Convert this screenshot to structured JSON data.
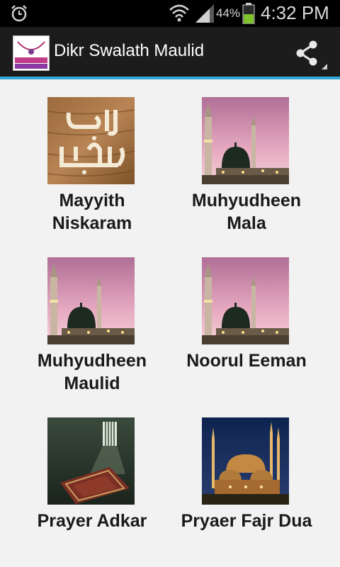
{
  "status_bar": {
    "battery_percent": "44%",
    "time": "4:32 PM",
    "icons": [
      "alarm-icon",
      "wifi-icon",
      "signal-icon",
      "battery-icon"
    ]
  },
  "action_bar": {
    "title": "Dikr Swalath Maulid",
    "logo_text": "adkar-aurad swalath-maulid",
    "share_icon": "share-icon"
  },
  "colors": {
    "accent": "#2fa7d8",
    "action_bar_bg": "#1c1c1c",
    "page_bg": "#f2f2f2",
    "battery": "#7ec22b"
  },
  "items": [
    {
      "label_line1": "Mayyith",
      "label_line2": "Niskaram",
      "image": "arabic-calligraphy-thumbnail"
    },
    {
      "label_line1": "Muhyudheen",
      "label_line2": "Mala",
      "image": "green-dome-mosque-thumbnail"
    },
    {
      "label_line1": "Muhyudheen",
      "label_line2": "Maulid",
      "image": "green-dome-mosque-thumbnail"
    },
    {
      "label_line1": "Noorul Eeman",
      "label_line2": "",
      "image": "green-dome-mosque-thumbnail"
    },
    {
      "label_line1": "Prayer Adkar",
      "label_line2": "",
      "image": "prayer-mat-thumbnail"
    },
    {
      "label_line1": "Pryaer Fajr Dua",
      "label_line2": "",
      "image": "blue-mosque-night-thumbnail"
    }
  ]
}
